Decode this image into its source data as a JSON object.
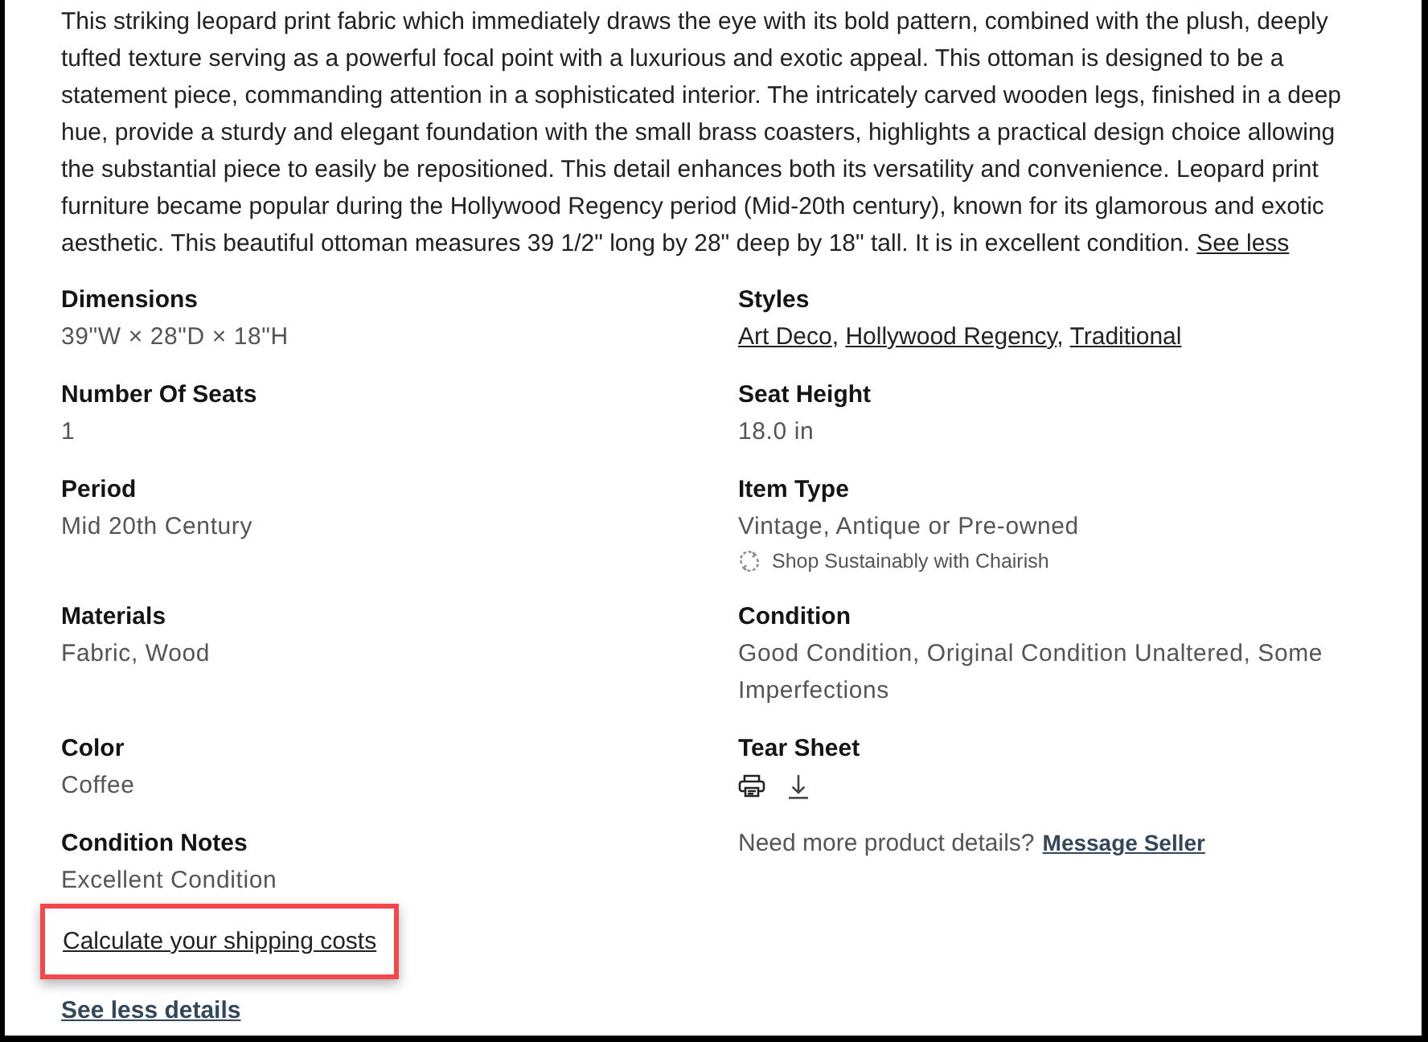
{
  "description": {
    "text": "This striking leopard print fabric which immediately draws the eye with its bold pattern, combined with the plush, deeply tufted texture serving as a powerful focal point with a luxurious and exotic appeal. This ottoman is designed to be a statement piece, commanding attention in a sophisticated interior. The intricately carved wooden legs, finished in a deep hue, provide a sturdy and elegant foundation with the small brass coasters, highlights a practical design choice allowing the substantial piece to easily be repositioned. This detail enhances both its versatility and convenience. Leopard print furniture became popular during the Hollywood Regency period (Mid-20th century), known for its glamorous and exotic aesthetic. This beautiful ottoman measures 39 1/2\" long by 28\" deep by 18\" tall. It is in excellent condition.",
    "link": "See less"
  },
  "details": [
    {
      "kind": "text",
      "label": "Dimensions",
      "value": "39\"W × 28\"D × 18\"H"
    },
    {
      "kind": "links",
      "label": "Styles",
      "links": [
        "Art Deco",
        "Hollywood Regency",
        "Traditional"
      ],
      "separator": ","
    },
    {
      "kind": "text",
      "label": "Number Of Seats",
      "value": "1"
    },
    {
      "kind": "text",
      "label": "Seat Height",
      "value": "18.0 in"
    },
    {
      "kind": "text",
      "label": "Period",
      "value": "Mid 20th Century"
    },
    {
      "kind": "text",
      "label": "Item Type",
      "value": "Vintage, Antique or Pre-owned",
      "note": "Shop Sustainably with Chairish"
    },
    {
      "kind": "text",
      "label": "Materials",
      "value": "Fabric, Wood"
    },
    {
      "kind": "text",
      "label": "Condition",
      "value": "Good Condition, Original Condition Unaltered, Some Imperfections"
    },
    {
      "kind": "text",
      "label": "Color",
      "value": "Coffee"
    },
    {
      "kind": "tear_sheet",
      "label": "Tear Sheet"
    },
    {
      "kind": "text",
      "label": "Condition Notes",
      "value": "Excellent Condition"
    },
    {
      "kind": "message",
      "text": "Need more product details?",
      "link": "Message Seller"
    }
  ],
  "shipping_link": {
    "text": "Calculate your shipping costs",
    "highlighted": true
  },
  "details_toggle": "See less details"
}
